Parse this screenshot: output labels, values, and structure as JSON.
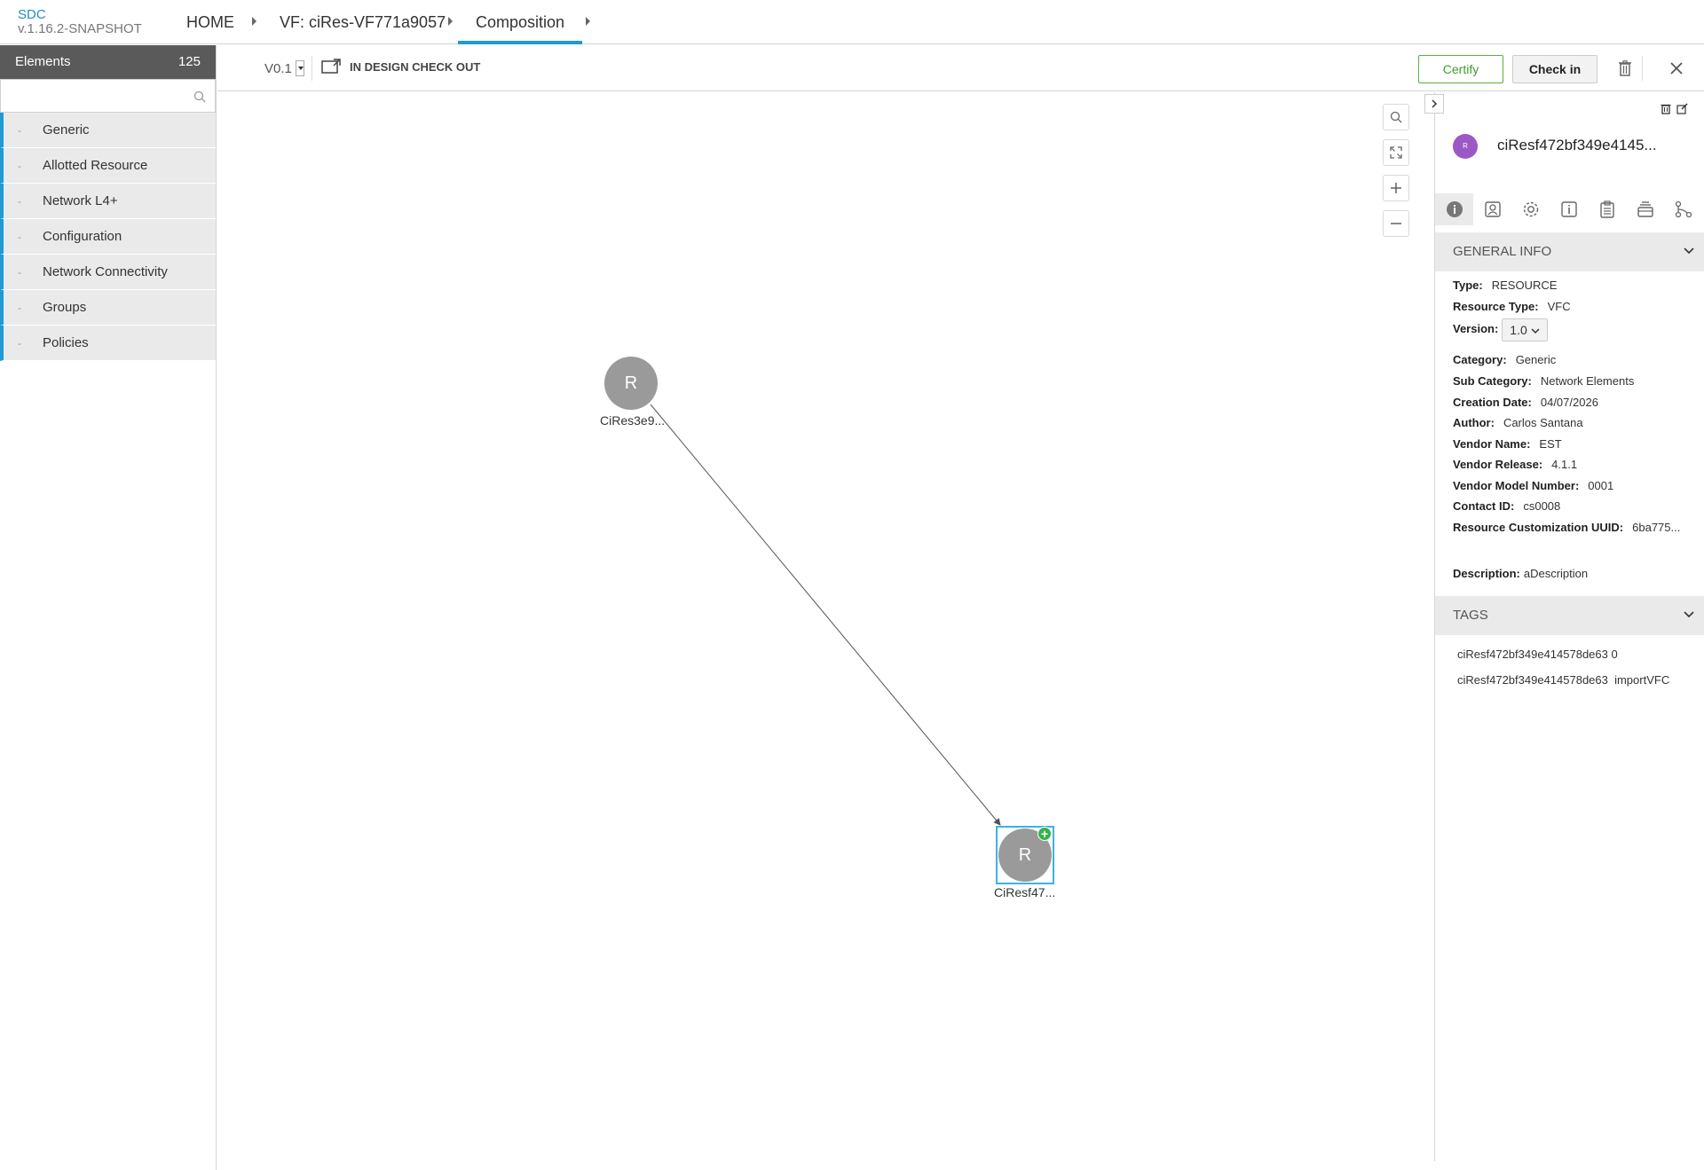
{
  "app": {
    "name": "SDC",
    "version": "v.1.16.2-SNAPSHOT"
  },
  "breadcrumbs": [
    {
      "label": "HOME"
    },
    {
      "label": "VF: ciRes-VF771a9057"
    },
    {
      "label": "Composition"
    }
  ],
  "palette": {
    "title": "Elements",
    "count": "125",
    "search_placeholder": "",
    "categories": [
      {
        "label": "Generic"
      },
      {
        "label": "Allotted Resource"
      },
      {
        "label": "Network L4+"
      },
      {
        "label": "Configuration"
      },
      {
        "label": "Network Connectivity"
      },
      {
        "label": "Groups"
      },
      {
        "label": "Policies"
      }
    ]
  },
  "toolbar": {
    "version": "V0.1",
    "state": "IN DESIGN CHECK OUT",
    "certify_label": "Certify",
    "checkin_label": "Check in"
  },
  "canvas": {
    "nodes": [
      {
        "letter": "R",
        "label": "CiRes3e9..."
      },
      {
        "letter": "R",
        "label": "CiResf47..."
      }
    ]
  },
  "panel": {
    "avatar_letter": "R",
    "component_name": "ciResf472bf349e4145...",
    "general_info_title": "GENERAL INFO",
    "general_info": {
      "type_label": "Type:",
      "type_value": "RESOURCE",
      "resource_type_label": "Resource Type:",
      "resource_type_value": "VFC",
      "version_label": "Version:",
      "version_value": "1.0",
      "category_label": "Category:",
      "category_value": "Generic",
      "sub_category_label": "Sub Category:",
      "sub_category_value": "Network Elements",
      "creation_date_label": "Creation Date:",
      "creation_date_value": "04/07/2026",
      "author_label": "Author:",
      "author_value": "Carlos Santana",
      "vendor_name_label": "Vendor Name:",
      "vendor_name_value": "EST",
      "vendor_release_label": "Vendor Release:",
      "vendor_release_value": "4.1.1",
      "vendor_model_label": "Vendor Model Number:",
      "vendor_model_value": "0001",
      "contact_label": "Contact ID:",
      "contact_value": "cs0008",
      "uuid_label": "Resource Customization UUID:",
      "uuid_value": "6ba775...",
      "description_label": "Description:",
      "description_value": "aDescription"
    },
    "tags_title": "TAGS",
    "tags": [
      {
        "text": "ciResf472bf349e414578de63 0"
      },
      {
        "text": "ciResf472bf349e414578de63  importVFC"
      }
    ]
  },
  "colors": {
    "accent": "#1e9ad6",
    "certify": "#3f9d2b",
    "avatar": "#9b59c6",
    "node": "#9a9a9a",
    "add_badge": "#36b24a"
  }
}
